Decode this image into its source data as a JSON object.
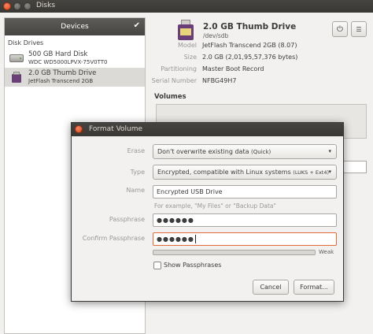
{
  "window": {
    "title": "Disks"
  },
  "sidebar": {
    "header": "Devices",
    "header_check": "✔",
    "section_label": "Disk Drives",
    "devices": [
      {
        "name": "500 GB Hard Disk",
        "detail": "WDC WD5000LPVX-75V0TT0",
        "icon": "hard-disk-icon"
      },
      {
        "name": "2.0 GB Thumb Drive",
        "detail": "JetFlash Transcend 2GB",
        "icon": "usb-drive-icon"
      }
    ]
  },
  "drive": {
    "title": "2.0 GB Thumb Drive",
    "path": "/dev/sdb",
    "properties": [
      {
        "key": "Model",
        "value": "JetFlash Transcend 2GB (8.07)"
      },
      {
        "key": "Size",
        "value": "2.0 GB (2,01,95,57,376 bytes)"
      },
      {
        "key": "Partitioning",
        "value": "Master Boot Record"
      },
      {
        "key": "Serial Number",
        "value": "NFBG49H7"
      }
    ],
    "volumes_label": "Volumes",
    "power_icon": "⏻",
    "menu_icon": "☰"
  },
  "dialog": {
    "title": "Format Volume",
    "close_glyph": "×",
    "erase": {
      "label": "Erase",
      "value": "Don't overwrite existing data",
      "suffix": "(Quick)"
    },
    "type": {
      "label": "Type",
      "value": "Encrypted, compatible with Linux systems",
      "suffix": "(LUKS + Ext4)"
    },
    "name": {
      "label": "Name",
      "value": "Encrypted USB Drive",
      "hint": "For example, \"My Files\" or \"Backup Data\""
    },
    "passphrase": {
      "label": "Passphrase",
      "dots": "●●●●●●"
    },
    "confirm": {
      "label": "Confirm Passphrase",
      "dots": "●●●●●●"
    },
    "strength": {
      "label": "Weak",
      "fraction": 0.0
    },
    "show_passphrases": {
      "label": "Show Passphrases",
      "checked": false
    },
    "cancel_label": "Cancel",
    "format_label": "Format..."
  }
}
